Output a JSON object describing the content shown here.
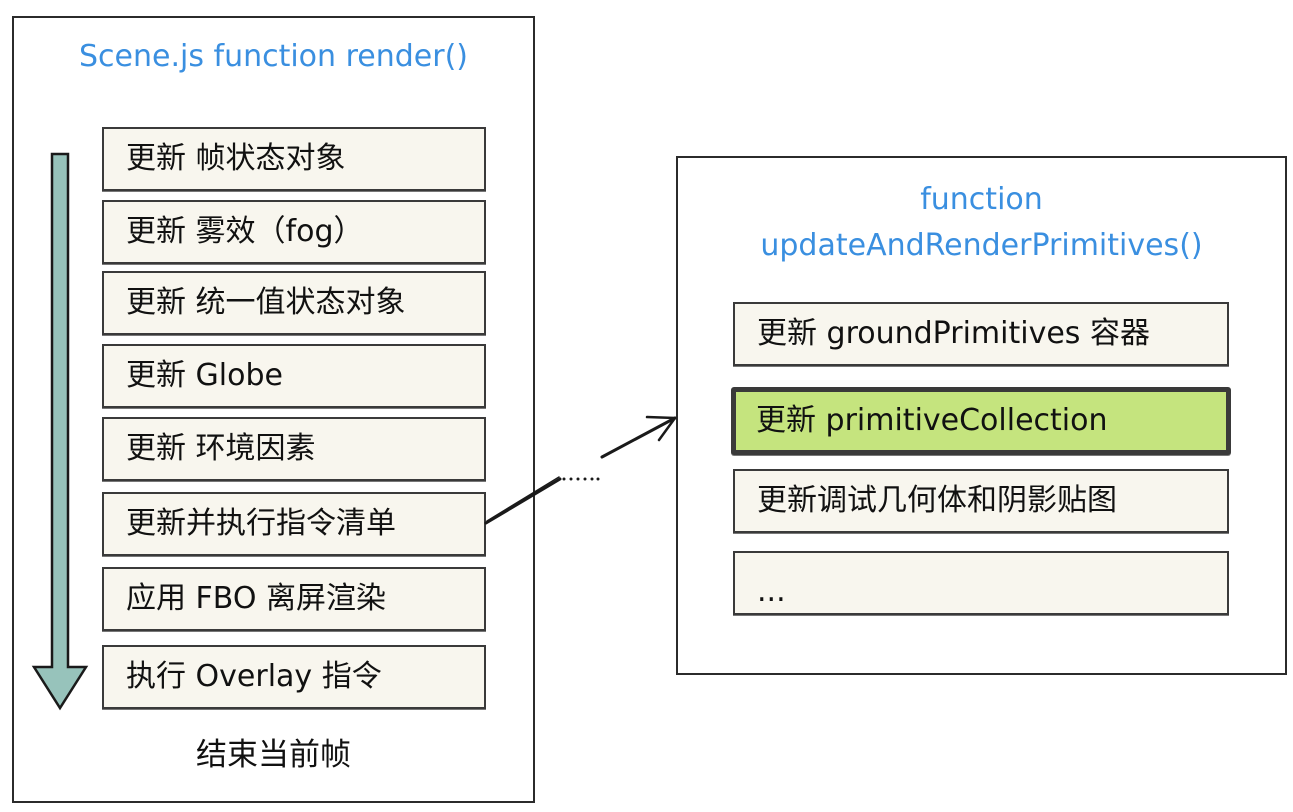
{
  "colors": {
    "title": "#3a8fe0",
    "step_fill": "#f8f6ee",
    "highlight_fill": "#c5e47e",
    "arrow_fill": "#97c3bb",
    "stroke": "#2b2b2b"
  },
  "left_panel": {
    "title": "Scene.js function render()",
    "steps": [
      "更新 帧状态对象",
      "更新 雾效（fog）",
      "更新 统一值状态对象",
      "更新 Globe",
      "更新 环境因素",
      "更新并执行指令清单",
      "应用 FBO 离屏渲染",
      "执行 Overlay 指令"
    ],
    "end_label": "结束当前帧",
    "flow_arrow_icon": "down-arrow-icon"
  },
  "connector": {
    "dots": "......",
    "from_step_index": 5,
    "to_step_index": 1
  },
  "right_panel": {
    "title_line1": "function",
    "title_line2": "updateAndRenderPrimitives()",
    "steps": [
      "更新 groundPrimitives 容器",
      "更新 primitiveCollection",
      "更新调试几何体和阴影贴图",
      "..."
    ],
    "highlighted_index": 1
  }
}
